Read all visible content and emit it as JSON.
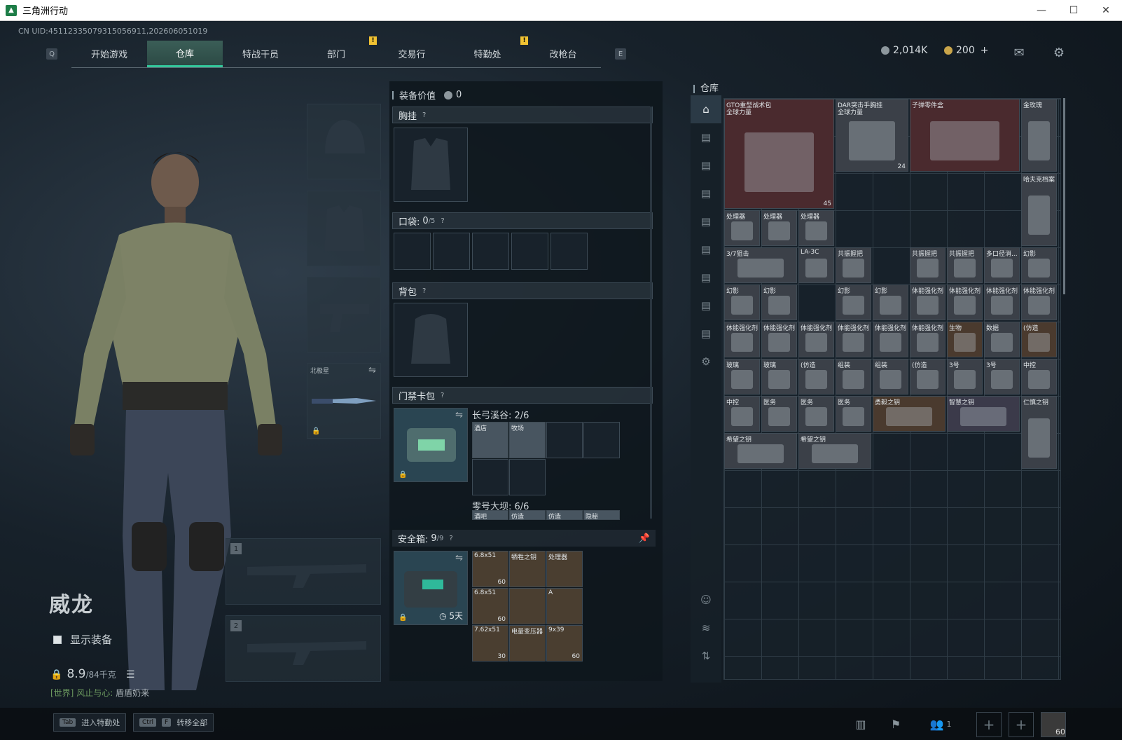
{
  "window": {
    "title": "三角洲行动",
    "minimize": "—",
    "maximize": "☐",
    "close": "✕"
  },
  "uid": "CN UID:45112335079315056911,202606051019",
  "nav": {
    "key_left": "Q",
    "key_right": "E",
    "tabs": [
      {
        "label": "开始游戏"
      },
      {
        "label": "仓库"
      },
      {
        "label": "特战干员"
      },
      {
        "label": "部门"
      },
      {
        "label": "交易行"
      },
      {
        "label": "特勤处"
      },
      {
        "label": "改枪台"
      }
    ],
    "alert": "!"
  },
  "currency": {
    "silver": "2,014K",
    "gold": "200",
    "gold_add": "+"
  },
  "character": {
    "name": "威龙",
    "show_equipment": "显示装备",
    "weight_value": "8.9",
    "weight_max": "/84千克",
    "chat_channel": "[世界]",
    "chat_user": "风止与心:",
    "chat_msg": "盾盾奶来"
  },
  "equip": {
    "melee_label": "北极星",
    "slot1": "1",
    "slot2": "2"
  },
  "mid": {
    "value_label": "装备价值",
    "value": "0",
    "chest": "胸挂",
    "pocket": "口袋:",
    "pocket_count": "0",
    "pocket_max": "/5",
    "backpack": "背包",
    "keycard": "门禁卡包",
    "q": "?",
    "map1": "长弓溪谷: 2/6",
    "map2": "零号大坝: 6/6",
    "map1_items": [
      "酒店",
      "牧场"
    ],
    "map2_items": [
      "酒吧",
      "仿造",
      "仿造",
      "隐秘"
    ],
    "safe_label": "安全箱:",
    "safe_count": "9",
    "safe_max": "/9",
    "safe_time": "5天",
    "safe_items": [
      {
        "name": "6.8x51",
        "count": "60"
      },
      {
        "name": "牺牲之钥",
        "count": ""
      },
      {
        "name": "处理器",
        "count": ""
      },
      {
        "name": "6.8x51",
        "count": "60"
      },
      {
        "name": "",
        "count": ""
      },
      {
        "name": "A",
        "count": ""
      },
      {
        "name": "7.62x51",
        "count": "30"
      },
      {
        "name": "电量变压器",
        "count": ""
      },
      {
        "name": "9x39",
        "count": "60"
      }
    ]
  },
  "warehouse": {
    "title": "仓库",
    "items": [
      {
        "name": "GTO重型战术包",
        "sub": "全球力量",
        "count": "45"
      },
      {
        "name": "DAR突击手胸挂",
        "sub": "全球力量",
        "count": "24"
      },
      {
        "name": "子弹零件盒",
        "sub": "",
        "count": ""
      },
      {
        "name": "金玫瑰",
        "sub": "",
        "count": ""
      },
      {
        "name": "哈夫克档案",
        "sub": "",
        "count": ""
      },
      {
        "name": "处理器",
        "sub": "",
        "count": ""
      },
      {
        "name": "处理器",
        "sub": "",
        "count": ""
      },
      {
        "name": "处理器",
        "sub": "",
        "count": ""
      },
      {
        "name": "3/7狙击",
        "sub": "",
        "count": ""
      },
      {
        "name": "LA-3C",
        "sub": "",
        "count": ""
      },
      {
        "name": "共振握把",
        "sub": "",
        "count": ""
      },
      {
        "name": "共振握把",
        "sub": "",
        "count": ""
      },
      {
        "name": "共振握把",
        "sub": "",
        "count": ""
      },
      {
        "name": "多口径消...",
        "sub": "",
        "count": ""
      },
      {
        "name": "幻影",
        "sub": "",
        "count": ""
      },
      {
        "name": "幻影",
        "sub": "",
        "count": ""
      },
      {
        "name": "幻影",
        "sub": "",
        "count": ""
      },
      {
        "name": "幻影",
        "sub": "",
        "count": ""
      },
      {
        "name": "幻影",
        "sub": "",
        "count": ""
      },
      {
        "name": "体能强化剂",
        "sub": "",
        "count": ""
      },
      {
        "name": "体能强化剂",
        "sub": "",
        "count": ""
      },
      {
        "name": "体能强化剂",
        "sub": "",
        "count": ""
      },
      {
        "name": "体能强化剂",
        "sub": "",
        "count": ""
      },
      {
        "name": "体能强化剂",
        "sub": "",
        "count": ""
      },
      {
        "name": "体能强化剂",
        "sub": "",
        "count": ""
      },
      {
        "name": "体能强化剂",
        "sub": "",
        "count": ""
      },
      {
        "name": "体能强化剂",
        "sub": "",
        "count": ""
      },
      {
        "name": "体能强化剂",
        "sub": "",
        "count": ""
      },
      {
        "name": "体能强化剂",
        "sub": "",
        "count": ""
      },
      {
        "name": "生物",
        "sub": "",
        "count": ""
      },
      {
        "name": "数据",
        "sub": "",
        "count": ""
      },
      {
        "name": "(仿造",
        "sub": "",
        "count": ""
      },
      {
        "name": "玻璃",
        "sub": "",
        "count": ""
      },
      {
        "name": "玻璃",
        "sub": "",
        "count": ""
      },
      {
        "name": "(仿造",
        "sub": "",
        "count": ""
      },
      {
        "name": "组装",
        "sub": "",
        "count": ""
      },
      {
        "name": "组装",
        "sub": "",
        "count": ""
      },
      {
        "name": "(仿造",
        "sub": "",
        "count": ""
      },
      {
        "name": "3号",
        "sub": "",
        "count": ""
      },
      {
        "name": "3号",
        "sub": "",
        "count": ""
      },
      {
        "name": "中控",
        "sub": "",
        "count": ""
      },
      {
        "name": "中控",
        "sub": "",
        "count": ""
      },
      {
        "name": "医务",
        "sub": "",
        "count": ""
      },
      {
        "name": "医务",
        "sub": "",
        "count": ""
      },
      {
        "name": "医务",
        "sub": "",
        "count": ""
      },
      {
        "name": "勇毅之钥",
        "sub": "",
        "count": ""
      },
      {
        "name": "智慧之钥",
        "sub": "",
        "count": ""
      },
      {
        "name": "仁慎之钥",
        "sub": "",
        "count": ""
      },
      {
        "name": "希望之钥",
        "sub": "",
        "count": ""
      },
      {
        "name": "希望之钥",
        "sub": "",
        "count": ""
      }
    ]
  },
  "bottom": {
    "tab_key": "Tab",
    "tab_label": "进入特勤处",
    "ctrl_key": "Ctrl",
    "f_key": "F",
    "ctrl_label": "转移全部",
    "friends": "1",
    "level": "60"
  }
}
